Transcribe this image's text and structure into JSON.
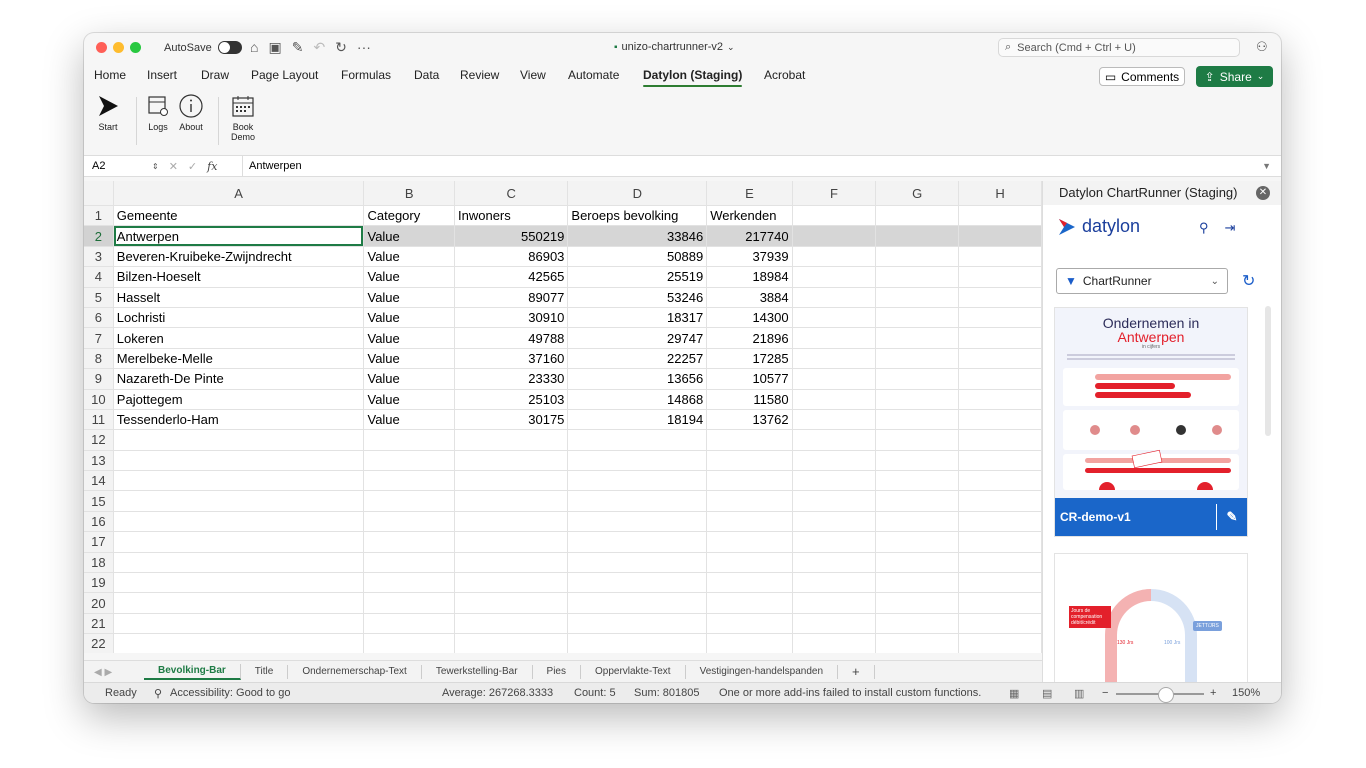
{
  "window": {
    "autosave_label": "AutoSave",
    "doc_title": "unizo-chartrunner-v2",
    "search_placeholder": "Search (Cmd + Ctrl + U)"
  },
  "menu": {
    "tabs": [
      "Home",
      "Insert",
      "Draw",
      "Page Layout",
      "Formulas",
      "Data",
      "Review",
      "View",
      "Automate",
      "Datylon (Staging)",
      "Acrobat"
    ],
    "active_tab": "Datylon (Staging)",
    "comments_label": "Comments",
    "share_label": "Share"
  },
  "ribbon": {
    "start": "Start",
    "logs": "Logs",
    "about": "About",
    "book_demo": "Book Demo"
  },
  "formula_bar": {
    "name_box": "A2",
    "content": "Antwerpen"
  },
  "sheet": {
    "columns": [
      "A",
      "B",
      "C",
      "D",
      "E",
      "F",
      "G",
      "H"
    ],
    "rows": [
      [
        "Gemeente",
        "Category",
        "Inwoners",
        "Beroeps bevolking",
        "Werkenden"
      ],
      [
        "Antwerpen",
        "Value",
        "550219",
        "33846",
        "217740"
      ],
      [
        "Beveren-Kruibeke-Zwijndrecht",
        "Value",
        "86903",
        "50889",
        "37939"
      ],
      [
        "Bilzen-Hoeselt",
        "Value",
        "42565",
        "25519",
        "18984"
      ],
      [
        "Hasselt",
        "Value",
        "89077",
        "53246",
        "3884"
      ],
      [
        "Lochristi",
        "Value",
        "30910",
        "18317",
        "14300"
      ],
      [
        "Lokeren",
        "Value",
        "49788",
        "29747",
        "21896"
      ],
      [
        "Merelbeke-Melle",
        "Value",
        "37160",
        "22257",
        "17285"
      ],
      [
        "Nazareth-De Pinte",
        "Value",
        "23330",
        "13656",
        "10577"
      ],
      [
        "Pajottegem",
        "Value",
        "25103",
        "14868",
        "11580"
      ],
      [
        "Tessenderlo-Ham",
        "Value",
        "30175",
        "18194",
        "13762"
      ]
    ],
    "row_numbers": [
      "1",
      "2",
      "3",
      "4",
      "5",
      "6",
      "7",
      "8",
      "9",
      "10",
      "11",
      "12",
      "13",
      "14",
      "15",
      "16",
      "17",
      "18",
      "19",
      "20",
      "21",
      "22"
    ],
    "selected_row": "2"
  },
  "sheet_tabs": [
    "Bevolking-Bar",
    "Title",
    "Ondernemerschap-Text",
    "Tewerkstelling-Bar",
    "Pies",
    "Oppervlakte-Text",
    "Vestigingen-handelspanden",
    "+"
  ],
  "active_sheet": "Bevolking-Bar",
  "status": {
    "ready": "Ready",
    "accessibility": "Accessibility: Good to go",
    "average": "Average: 267268.3333",
    "count": "Count: 5",
    "sum": "Sum: 801805",
    "warning": "One or more add-ins failed to install custom functions.",
    "zoom": "150%"
  },
  "pane": {
    "title": "Datylon ChartRunner (Staging)",
    "logo_text": "datylon",
    "filter_label": "ChartRunner",
    "card1": {
      "title": "Ondernemen in",
      "city": "Antwerpen",
      "subtitle": "in cijfers",
      "name": "CR-demo-v1"
    },
    "card2": {
      "tag": "Jours de compensation débit/crédit",
      "badge": "JETT/JRS",
      "val_a": "130 Jrs",
      "val_b": "100 Jrs"
    }
  },
  "colors": {
    "brand_green": "#1e7b45",
    "datylon_blue": "#1a3e9c",
    "card_blue": "#1a66c9",
    "accent_red": "#e3202b"
  }
}
